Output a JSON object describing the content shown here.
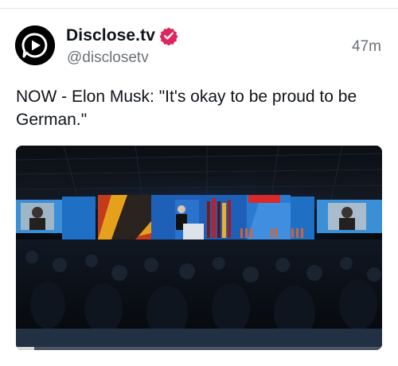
{
  "post": {
    "display_name": "Disclose.tv",
    "handle": "@disclosetv",
    "timestamp": "47m",
    "text": "NOW - Elon Musk: \"It's okay to be proud to be German.\"",
    "verified": true,
    "avatar_icon": "play-speech-bubble-icon",
    "verified_icon": "checkmark-badge-icon"
  },
  "media": {
    "type": "video",
    "progress": 0.05
  },
  "colors": {
    "verified_badge": "#e0245e",
    "text_primary": "#0f1419",
    "text_secondary": "#6b7177",
    "divider": "#e6e6e6"
  }
}
